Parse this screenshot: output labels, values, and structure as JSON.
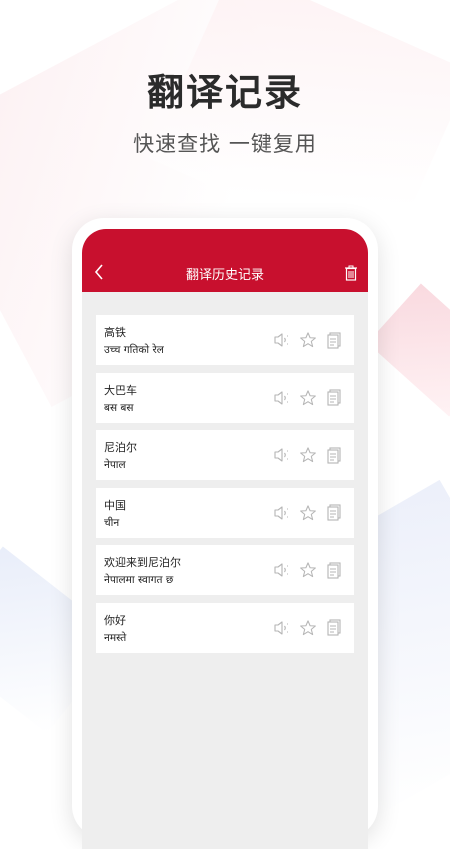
{
  "promo": {
    "title": "翻译记录",
    "subtitle": "快速查找 一键复用"
  },
  "header": {
    "back_icon": "chevron-left-icon",
    "title": "翻译历史记录",
    "trash_icon": "trash-icon"
  },
  "colors": {
    "brand": "#c8102e",
    "list_bg": "#eeeeee",
    "icon_gray": "#b5b5b5"
  },
  "history": [
    {
      "source": "高铁",
      "target": "उच्च गतिको रेल"
    },
    {
      "source": "大巴车",
      "target": "बस बस"
    },
    {
      "source": "尼泊尔",
      "target": "नेपाल"
    },
    {
      "source": "中国",
      "target": "चीन"
    },
    {
      "source": "欢迎来到尼泊尔",
      "target": "नेपालमा स्वागत छ"
    },
    {
      "source": "你好",
      "target": "नमस्ते"
    }
  ],
  "row_icons": [
    "speaker-icon",
    "star-icon",
    "copy-icon"
  ]
}
